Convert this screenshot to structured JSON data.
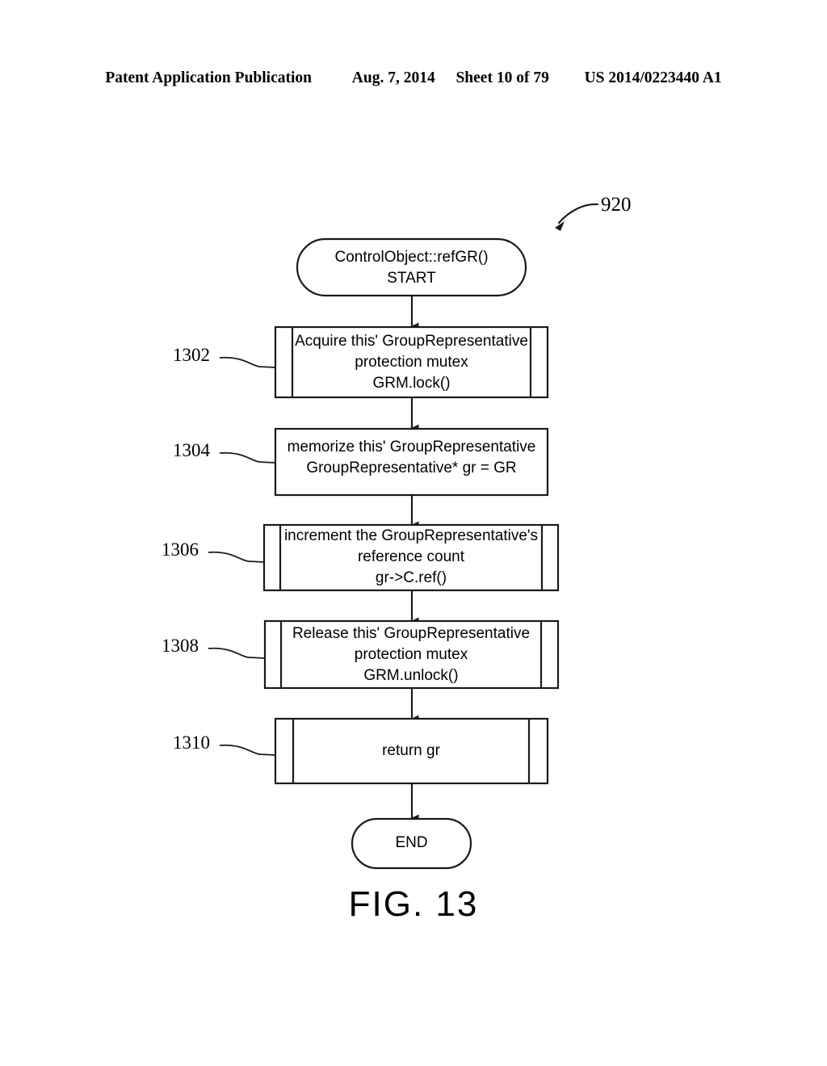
{
  "header": {
    "publication": "Patent Application Publication",
    "date": "Aug. 7, 2014",
    "sheet": "Sheet 10 of 79",
    "number": "US 2014/0223440 A1"
  },
  "figure": {
    "caption": "FIG. 13",
    "diagram_ref": "920"
  },
  "flowchart": {
    "start": {
      "ref": "",
      "line1": "ControlObject::refGR()",
      "line2": "START"
    },
    "steps": [
      {
        "ref": "1302",
        "shape": "predefined-process",
        "line1": "Acquire this' GroupRepresentative",
        "line2": "protection mutex",
        "line3": "GRM.lock()"
      },
      {
        "ref": "1304",
        "shape": "process",
        "line1": "memorize this' GroupRepresentative",
        "line2": "GroupRepresentative* gr = GR",
        "line3": ""
      },
      {
        "ref": "1306",
        "shape": "predefined-process",
        "line1": "increment the GroupRepresentative's",
        "line2": "reference count",
        "line3": "gr->C.ref()"
      },
      {
        "ref": "1308",
        "shape": "predefined-process",
        "line1": "Release this' GroupRepresentative",
        "line2": "protection mutex",
        "line3": "GRM.unlock()"
      },
      {
        "ref": "1310",
        "shape": "predefined-process",
        "line1": "return gr",
        "line2": "",
        "line3": ""
      }
    ],
    "end": {
      "label": "END"
    }
  },
  "colors": {
    "ink": "#1a1a1a",
    "paper": "#ffffff"
  }
}
